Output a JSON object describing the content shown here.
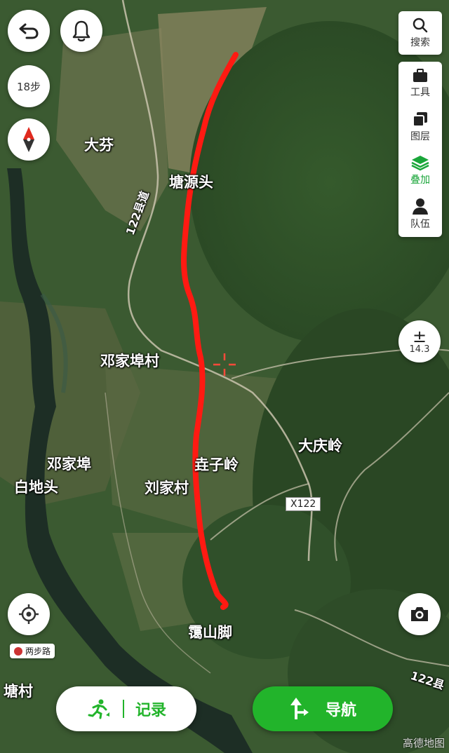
{
  "map_labels": {
    "dafen": "大芬",
    "tangyuantou": "塘源头",
    "road_122": "122县道",
    "dengjiabu_village": "邓家埠村",
    "dengjiabu": "邓家埠",
    "baidetou": "白地头",
    "daqingling": "大庆岭",
    "zhuziling": "垚子岭",
    "liujiacun": "刘家村",
    "x122": "X122",
    "leishanjiao": "霭山脚",
    "tangcun": "塘村",
    "road_122_bottom": "122县"
  },
  "controls": {
    "steps_label": "18步",
    "zoom_value": "14.3",
    "zoom_symbol": "±",
    "road_mode_label": "两步路"
  },
  "toolbar": {
    "search": "搜索",
    "tools": "工具",
    "layers": "图层",
    "overlay": "叠加",
    "team": "队伍"
  },
  "bottom": {
    "record_label": "记录",
    "navigate_label": "导航"
  },
  "watermark": "高德地图",
  "colors": {
    "route": "#ff1a12",
    "accent_green": "#22b42b",
    "overlay_green": "#1aa63a"
  }
}
